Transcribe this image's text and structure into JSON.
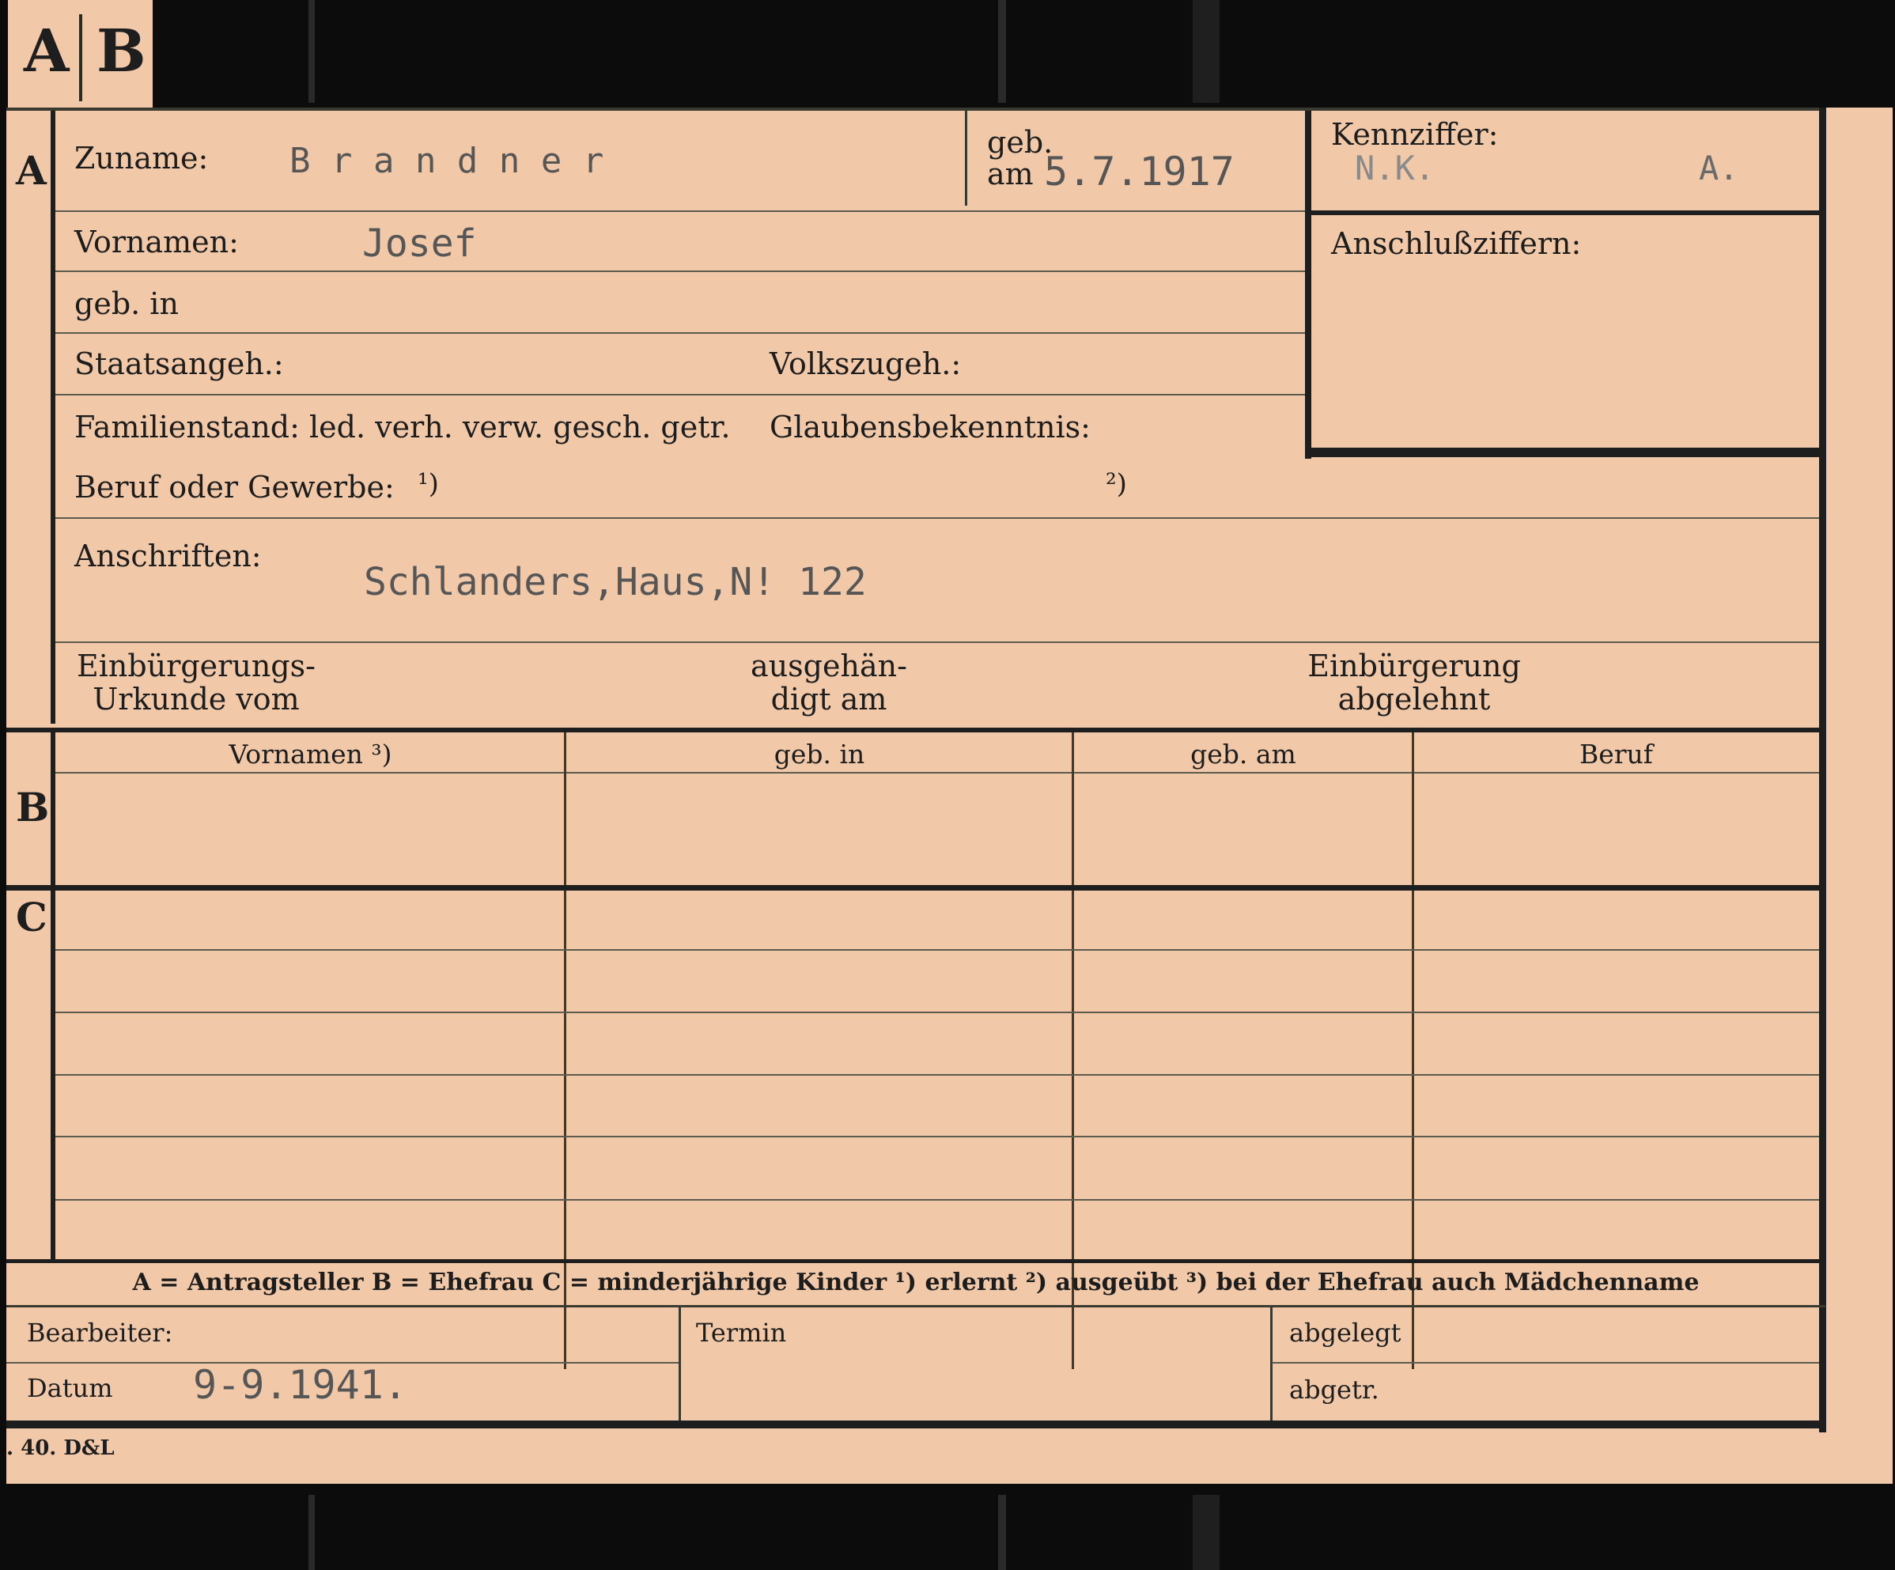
{
  "tab": {
    "left": "A",
    "right": "B"
  },
  "sections": {
    "a": "A",
    "b": "B",
    "c": "C"
  },
  "fields": {
    "zuname_label": "Zuname:",
    "zuname_value": "B r a n d n e r",
    "geb_label": "geb.",
    "am_label": "am",
    "geb_am_value": "5.7.1917",
    "kennziffer_label": "Kennziffer:",
    "kennziffer_value_1": "N.K.",
    "kennziffer_value_2": "A.",
    "anschlussziffern_label": "Anschlußziffern:",
    "vornamen_label": "Vornamen:",
    "vornamen_value": "Josef",
    "geb_in_label": "geb. in",
    "staatsangeh_label": "Staatsangeh.:",
    "volkszugeh_label": "Volkszugeh.:",
    "familienstand_label": "Familienstand: led. verh. verw. gesch. getr.",
    "glaubensbekenntnis_label": "Glaubensbekenntnis:",
    "beruf_label": "Beruf oder Gewerbe:",
    "note1": "¹)",
    "note2": "²)",
    "anschriften_label": "Anschriften:",
    "anschriften_value": "Schlanders,Haus,N! 122",
    "einbuergerungs_line1": "Einbürgerungs-",
    "einbuergerungs_line2": "Urkunde vom",
    "ausgehaendigt_line1": "ausgehän-",
    "ausgehaendigt_line2": "digt am",
    "einbuergerung_line1": "Einbürgerung",
    "einbuergerung_line2": "abgelehnt"
  },
  "table": {
    "headers": [
      "Vornamen ³)",
      "geb. in",
      "geb. am",
      "Beruf"
    ]
  },
  "legend": "A = Antragsteller   B = Ehefrau   C = minderjährige Kinder   ¹) erlernt   ²) ausgeübt   ³) bei der Ehefrau auch Mädchenname",
  "bottom": {
    "bearbeiter_label": "Bearbeiter:",
    "termin_label": "Termin",
    "abgelegt_label": "abgelegt",
    "datum_label": "Datum",
    "datum_value": "9-9.1941.",
    "abgetr_label": "abgetr."
  },
  "print_mark": ". 40. D&L"
}
